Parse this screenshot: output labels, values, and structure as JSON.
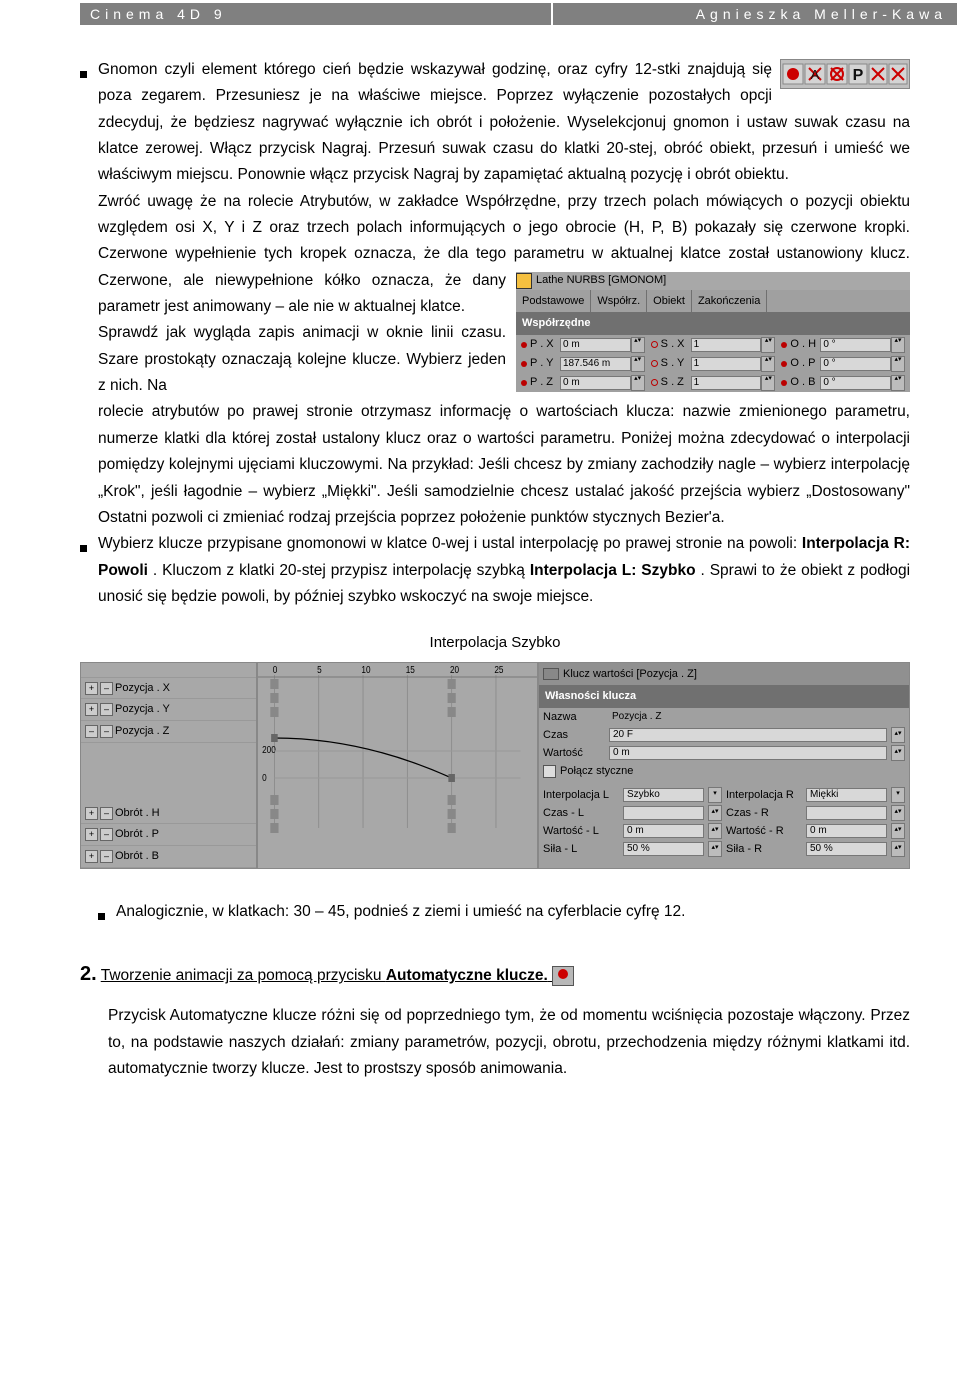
{
  "header": {
    "left": "Cinema 4D 9",
    "right": "Agnieszka Meller-Kawa"
  },
  "para1": {
    "t1": "Gnomon czyli element którego cień będzie wskazywał godzinę, oraz cyfry 12-stki znajdują się poza zegarem. Przesuniesz je na właściwe miejsce. Poprzez wyłączenie pozostałych opcji zdecyduj, że będziesz nagrywać wyłącznie ich obrót i położenie. Wyselekcjonuj gnomon i ustaw suwak czasu na klatce zerowej. Włącz przycisk Nagraj. Przesuń suwak czasu do klatki 20-stej, obróć obiekt, przesuń i umieść we właściwym miejscu. Ponownie włącz przycisk Nagraj by zapamiętać aktualną pozycję i obrót obiektu.",
    "t2": "Zwróć uwagę że na rolecie Atrybutów, w zakładce Współrzędne, przy trzech polach mówiących o pozycji obiektu względem osi X, Y i Z oraz trzech polach informujących o jego obrocie (H, P, B) pokazały się czerwone kropki. Czerwone wypełnienie tych kropek oznacza, że dla tego parametru w aktualnej klatce został ustanowiony klucz.",
    "t3a": "Czerwone, ale niewypełnione kółko oznacza, że dany parametr jest animowany – ale nie w aktualnej klatce.",
    "t3b": "Sprawdź jak wygląda zapis animacji w oknie linii czasu. Szare prostokąty oznaczają kolejne klucze. Wybierz jeden z nich. Na",
    "t4": "rolecie atrybutów po prawej stronie otrzymasz informację o wartościach klucza: nazwie zmienionego parametru, numerze klatki dla której został ustalony klucz oraz o wartości parametru. Poniżej można zdecydować o interpolacji pomiędzy kolejnymi ujęciami kluczowymi. Na przykład: Jeśli chcesz by zmiany zachodziły nagle – wybierz interpolację „Krok\", jeśli łagodnie – wybierz „Miękki\". Jeśli samodzielnie chcesz ustalać jakość przejścia wybierz „Dostosowany\" Ostatni pozwoli ci zmieniać rodzaj przejścia poprzez położenie punktów stycznych Bezier'a."
  },
  "para2": {
    "t1": "Wybierz klucze przypisane gnomonowi w klatce 0-wej i ustal interpolację po prawej stronie na powoli: ",
    "b1": "Interpolacja R: Powoli",
    "t2": ". Kluczom z klatki 20-stej przypisz interpolację szybką ",
    "b2": "Interpolacja L: Szybko",
    "t3": ". Sprawi to że obiekt z podłogi unosić się będzie powoli, by później szybko wskoczyć na swoje miejsce."
  },
  "annot": "Interpolacja Szybko",
  "attrpanel": {
    "title": "Lathe NURBS [GMONOM]",
    "tabs": [
      "Podstawowe",
      "Współrz.",
      "Obiekt",
      "Zakończenia"
    ],
    "section": "Współrzędne",
    "rows": [
      {
        "p": "P . X",
        "pv": "0 m",
        "s": "S . X",
        "sv": "1",
        "o": "O . H",
        "ov": "0 °"
      },
      {
        "p": "P . Y",
        "pv": "187.546 m",
        "s": "S . Y",
        "sv": "1",
        "o": "O . P",
        "ov": "0 °"
      },
      {
        "p": "P . Z",
        "pv": "0 m",
        "s": "S . Z",
        "sv": "1",
        "o": "O . B",
        "ov": "0 °"
      }
    ]
  },
  "timeline": {
    "ticks": [
      "0",
      "5",
      "10",
      "15",
      "20",
      "25"
    ],
    "tracks1": [
      "Pozycja . X",
      "Pozycja . Y",
      "Pozycja . Z"
    ],
    "tracks2": [
      "Obrót . H",
      "Obrót . P",
      "Obrót . B"
    ],
    "ymarks": [
      "200",
      "0"
    ]
  },
  "keyprops": {
    "title": "Klucz wartości [Pozycja . Z]",
    "section": "Własności klucza",
    "name_l": "Nazwa",
    "name_v": "Pozycja . Z",
    "time_l": "Czas",
    "time_v": "20 F",
    "val_l": "Wartość",
    "val_v": "0 m",
    "tang": "Połącz styczne",
    "il_l": "Interpolacja L",
    "il_v": "Szybko",
    "ir_l": "Interpolacja R",
    "ir_v": "Miękki",
    "cl_l": "Czas - L",
    "cl_v": "",
    "cr_l": "Czas - R",
    "cr_v": "",
    "wl_l": "Wartość - L",
    "wl_v": "0 m",
    "wr_l": "Wartość - R",
    "wr_v": "0 m",
    "sl_l": "Siła - L",
    "sl_v": "50 %",
    "sr_l": "Siła - R",
    "sr_v": "50 %"
  },
  "para3": "Analogicznie, w klatkach: 30 – 45, podnieś z ziemi i umieść na cyferblacie cyfrę 12.",
  "section2": {
    "num": "2.",
    "title": "Tworzenie animacji za pomocą przycisku ",
    "title_u": "Automatyczne klucze.",
    "body": "Przycisk Automatyczne klucze różni się od poprzedniego tym, że od momentu wciśnięcia pozostaje włączony. Przez to, na podstawie naszych działań: zmiany parametrów, pozycji, obrotu, przechodzenia między różnymi klatkami itd. automatycznie tworzy klucze. Jest to prostszy sposób animowania."
  }
}
